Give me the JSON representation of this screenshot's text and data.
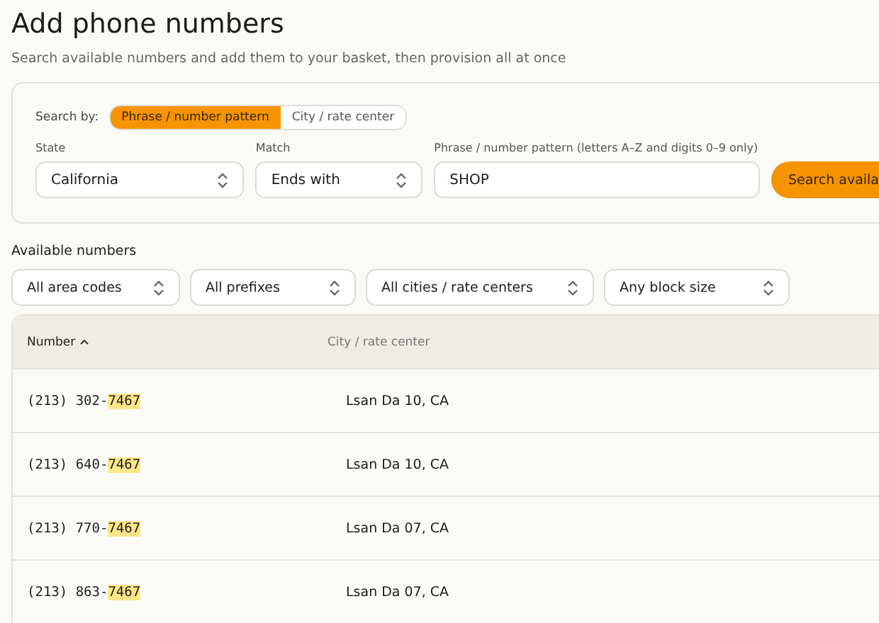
{
  "title": "Add phone numbers",
  "subtitle": "Search available numbers and add them to your basket, then provision all at once",
  "search_by": {
    "label": "Search by:",
    "options": [
      {
        "label": "Phrase / number pattern",
        "selected": true
      },
      {
        "label": "City / rate center",
        "selected": false
      }
    ]
  },
  "fields": [
    {
      "label": "State",
      "value": "California",
      "kind": "select"
    },
    {
      "label": "Match",
      "value": "Ends with",
      "kind": "select"
    },
    {
      "label": "Phrase / number pattern (letters A–Z and digits 0–9 only)",
      "value": "SHOP",
      "kind": "text"
    }
  ],
  "search_button": "Search availa",
  "section_title": "Available numbers",
  "filters": [
    "All area codes",
    "All prefixes",
    "All cities / rate centers",
    "Any block size"
  ],
  "table": {
    "columns": [
      {
        "label": "Number",
        "sorted": true
      },
      {
        "label": "City / rate center",
        "sorted": false
      }
    ],
    "rows": [
      {
        "number_start": "(213) 302-",
        "number_match": "7467",
        "city": "Lsan Da 10, CA"
      },
      {
        "number_start": "(213) 640-",
        "number_match": "7467",
        "city": "Lsan Da 10, CA"
      },
      {
        "number_start": "(213) 770-",
        "number_match": "7467",
        "city": "Lsan Da 07, CA"
      },
      {
        "number_start": "(213) 863-",
        "number_match": "7467",
        "city": "Lsan Da 07, CA"
      }
    ]
  }
}
